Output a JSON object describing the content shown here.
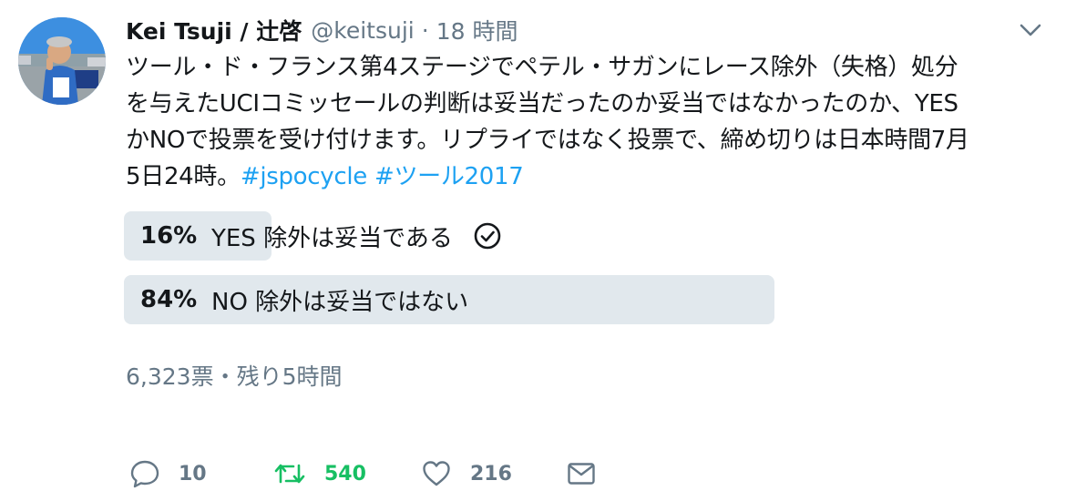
{
  "tweet": {
    "author_name": "Kei Tsuji / 辻啓",
    "screen_name": "@keitsuji",
    "separator": "·",
    "time": "18 時間",
    "text_lines": [
      "ツール・ド・フランス第4ステージでペテル・サガンにレース除外（失格）処分",
      "を与えたUCIコミッセールの判断は妥当だったのか妥当ではなかったのか、YES",
      "かNOで投票を受け付けます。リプライではなく投票で、締め切りは日本時間7月"
    ],
    "text_last_prefix": "5日24時。",
    "hashtags": [
      "#jspocycle",
      "#ツール2017"
    ]
  },
  "poll": {
    "choices": [
      {
        "percent_label": "16%",
        "label": "YES 除外は妥当である",
        "percent": 16,
        "selected": true
      },
      {
        "percent_label": "84%",
        "label": "NO 除外は妥当ではない",
        "percent": 84,
        "selected": false
      }
    ],
    "meta": "6,323票・残り5時間"
  },
  "actions": {
    "reply_count": "10",
    "retweet_count": "540",
    "like_count": "216"
  },
  "colors": {
    "text": "#14171a",
    "secondary": "#657786",
    "hashtag": "#1da1f2",
    "poll_bar": "#e1e8ed",
    "retweet_active": "#17bf63"
  },
  "icons": [
    "avatar",
    "chevron-down-icon",
    "check-circle-icon",
    "reply-icon",
    "retweet-icon",
    "like-icon",
    "dm-icon"
  ]
}
